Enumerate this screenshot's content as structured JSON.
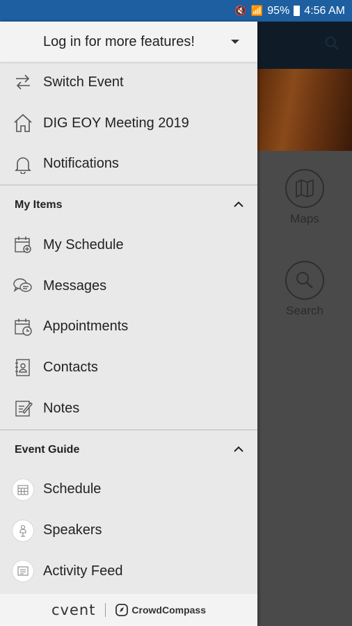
{
  "status_bar": {
    "battery": "95%",
    "time": "4:56 AM"
  },
  "drawer": {
    "login_prompt": "Log in for more features!",
    "top_items": [
      {
        "label": "Switch Event",
        "icon": "switch-arrows-icon"
      },
      {
        "label": "DIG EOY Meeting 2019",
        "icon": "home-icon"
      },
      {
        "label": "Notifications",
        "icon": "bell-icon"
      }
    ],
    "my_items": {
      "title": "My Items",
      "items": [
        {
          "label": "My Schedule",
          "icon": "calendar-add-icon"
        },
        {
          "label": "Messages",
          "icon": "chat-bubbles-icon"
        },
        {
          "label": "Appointments",
          "icon": "calendar-clock-icon"
        },
        {
          "label": "Contacts",
          "icon": "contact-card-icon"
        },
        {
          "label": "Notes",
          "icon": "note-pencil-icon"
        }
      ]
    },
    "event_guide": {
      "title": "Event Guide",
      "items": [
        {
          "label": "Schedule",
          "icon": "calendar-grid-icon"
        },
        {
          "label": "Speakers",
          "icon": "speaker-person-icon"
        },
        {
          "label": "Activity Feed",
          "icon": "feed-list-icon"
        }
      ]
    },
    "footer": {
      "brand": "cvent",
      "partner": "CrowdCompass"
    }
  },
  "background": {
    "tiles": [
      {
        "label": "Maps",
        "icon": "map-icon"
      },
      {
        "label": "Search",
        "icon": "search-icon"
      }
    ]
  }
}
